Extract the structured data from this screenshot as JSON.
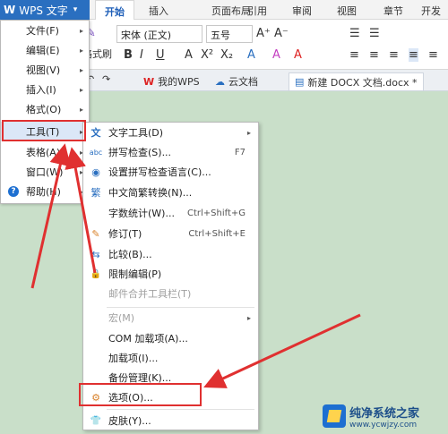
{
  "app": {
    "button_logo": "W",
    "button_label": "WPS 文字",
    "button_caret": "▾"
  },
  "ribbon": {
    "tabs": [
      "开始",
      "插入",
      "页面布局",
      "引用",
      "审阅",
      "视图",
      "章节",
      "开发工"
    ],
    "font_name": "宋体 (正文)",
    "font_size": "五号",
    "format_brush_label": "格式刷",
    "icons": [
      "B",
      "I",
      "U",
      "A",
      "X²",
      "X₂",
      "A",
      "A",
      "A",
      "A⁺",
      "A⁻"
    ]
  },
  "doc_tabs": [
    {
      "label": "我的WPS",
      "icon": "W"
    },
    {
      "label": "云文档",
      "icon": "☁"
    },
    {
      "label": "新建 DOCX 文档.docx *",
      "icon": "▤",
      "active": true
    }
  ],
  "main_menu": [
    {
      "label": "文件(F)",
      "has_arrow": true
    },
    {
      "label": "编辑(E)",
      "has_arrow": true
    },
    {
      "label": "视图(V)",
      "has_arrow": true
    },
    {
      "label": "插入(I)",
      "has_arrow": true
    },
    {
      "label": "格式(O)",
      "has_arrow": true
    },
    {
      "label": "工具(T)",
      "has_arrow": true,
      "active": true
    },
    {
      "label": "表格(A)",
      "has_arrow": true
    },
    {
      "label": "窗口(W)",
      "has_arrow": true
    },
    {
      "label": "帮助(H)",
      "has_arrow": true
    }
  ],
  "tools_menu": [
    {
      "label": "文字工具(D)",
      "icon": "文",
      "arrow": "▸"
    },
    {
      "label": "拼写检查(S)...",
      "icon": "abc",
      "shortcut": "F7"
    },
    {
      "label": "设置拼写检查语言(C)...",
      "icon": "◉"
    },
    {
      "label": "中文简繁转换(N)...",
      "icon": "繁"
    },
    {
      "label": "字数统计(W)...",
      "shortcut": "Ctrl+Shift+G"
    },
    {
      "label": "修订(T)",
      "icon": "✎",
      "shortcut": "Ctrl+Shift+E"
    },
    {
      "label": "比较(B)...",
      "icon": "⇆"
    },
    {
      "label": "限制编辑(P)",
      "icon": "🔒"
    },
    {
      "label": "邮件合并工具栏(T)",
      "disabled": true
    },
    {
      "label": "宏(M)",
      "disabled": true,
      "arrow": "▸"
    },
    {
      "label": "COM 加载项(A)..."
    },
    {
      "label": "加载项(I)..."
    },
    {
      "label": "备份管理(K)..."
    },
    {
      "label": "选项(O)...",
      "icon": "⚙"
    },
    {
      "label": "皮肤(Y)...",
      "icon": "👕"
    }
  ],
  "watermark": {
    "title": "纯净系统之家",
    "url": "www.ycwjzy.com"
  },
  "colors": {
    "accent": "#2a6fc0",
    "highlight": "#e03030",
    "background": "#c9dfc9"
  }
}
